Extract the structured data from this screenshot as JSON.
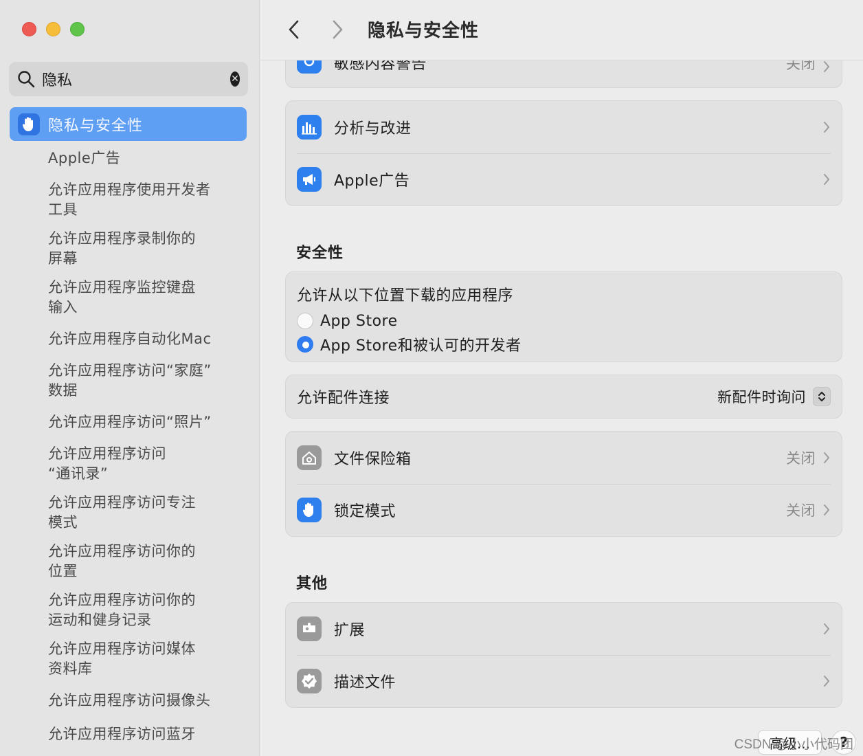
{
  "window": {
    "title": "隐私与安全性"
  },
  "search": {
    "value": "隐私",
    "clear_glyph": "✕"
  },
  "sidebar": {
    "active_label": "隐私与安全性",
    "items": [
      "Apple广告",
      "允许应用程序使用开发者\n工具",
      "允许应用程序录制你的\n屏幕",
      "允许应用程序监控键盘\n输入",
      "允许应用程序自动化Mac",
      "允许应用程序访问“家庭”\n数据",
      "允许应用程序访问“照片”",
      "允许应用程序访问\n“通讯录”",
      "允许应用程序访问专注\n模式",
      "允许应用程序访问你的\n位置",
      "允许应用程序访问你的\n运动和健身记录",
      "允许应用程序访问媒体\n资料库",
      "允许应用程序访问摄像头",
      "允许应用程序访问蓝牙"
    ]
  },
  "main": {
    "partial_row": {
      "label": "敏感内容警告",
      "value": "关闭"
    },
    "group1": [
      {
        "label": "分析与改进",
        "icon": "chart-bars-icon"
      },
      {
        "label": "Apple广告",
        "icon": "megaphone-icon"
      }
    ],
    "security": {
      "title": "安全性",
      "download_title": "允许从以下位置下载的应用程序",
      "options": [
        {
          "label": "App Store",
          "checked": false
        },
        {
          "label": "App Store和被认可的开发者",
          "checked": true
        }
      ],
      "accessory_label": "允许配件连接",
      "accessory_value": "新配件时询问",
      "items": [
        {
          "label": "文件保险箱",
          "value": "关闭",
          "icon": "house-lock-icon"
        },
        {
          "label": "锁定模式",
          "value": "关闭",
          "icon": "hand-icon"
        }
      ]
    },
    "other": {
      "title": "其他",
      "items": [
        {
          "label": "扩展",
          "icon": "puzzle-icon"
        },
        {
          "label": "描述文件",
          "icon": "checkmark-badge-icon"
        }
      ]
    },
    "advanced_button": "高级...",
    "help_button": "?",
    "watermark": "CSDN @小小代码团"
  },
  "colors": {
    "accent": "#2e80ee",
    "sidebar_selected": "#5f9ff3"
  }
}
